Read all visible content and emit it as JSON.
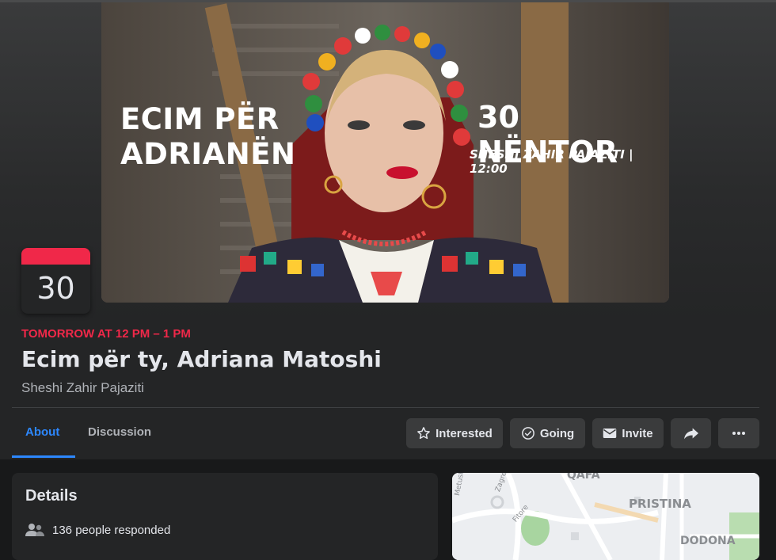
{
  "cover": {
    "headline": [
      "ECIM PËR",
      "ADRIANËN"
    ],
    "date": "30 NËNTOR",
    "place_time": "SHESHI ZAHIR PAJAZITI | 12:00"
  },
  "calendar": {
    "day": "30",
    "accent": "#f02849"
  },
  "event": {
    "time": "TOMORROW AT 12 PM – 1 PM",
    "title": "Ecim për ty, Adriana Matoshi",
    "location": "Sheshi Zahir Pajaziti"
  },
  "tabs": [
    {
      "label": "About",
      "active": true
    },
    {
      "label": "Discussion",
      "active": false
    }
  ],
  "actions": {
    "interested": {
      "label": "Interested",
      "icon": "star-icon"
    },
    "going": {
      "label": "Going",
      "icon": "check-circle-icon"
    },
    "invite": {
      "label": "Invite",
      "icon": "envelope-icon"
    },
    "share": {
      "icon": "share-arrow-icon"
    },
    "more": {
      "icon": "more-dots-icon"
    }
  },
  "details": {
    "title": "Details",
    "responded": "136 people responded"
  },
  "map": {
    "labels": [
      "QAFA",
      "PRISTINA",
      "DODONA",
      "Metush K",
      "Zagreb",
      "Fitore"
    ]
  },
  "colors": {
    "accent_blue": "#2d88ff",
    "accent_red": "#f02849",
    "background": "#18191a",
    "surface": "#242526"
  }
}
